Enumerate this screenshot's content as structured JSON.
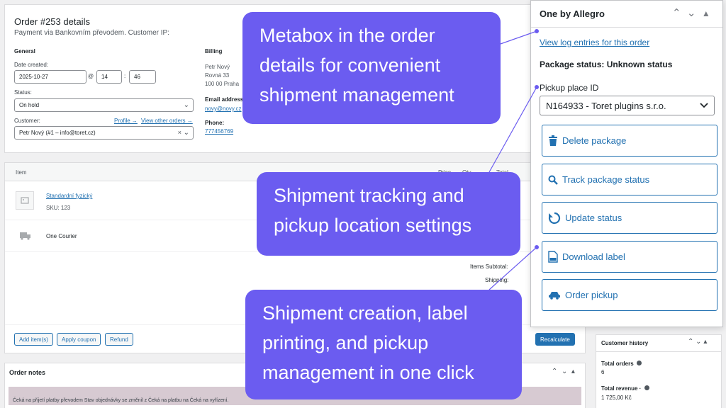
{
  "order": {
    "title": "Order #253 details",
    "subtitle": "Payment via Bankovním převodem. Customer IP:",
    "general_heading": "General",
    "date_label": "Date created:",
    "date_value": "2025-10-27",
    "at_sign": "@",
    "hour": "14",
    "colon": ":",
    "minute": "46",
    "status_label": "Status:",
    "status_value": "On hold",
    "customer_label": "Customer:",
    "profile_link": "Profile →",
    "other_orders_link": "View other orders →",
    "customer_value": "Petr Nový (#1 – info@toret.cz)",
    "billing_heading": "Billing",
    "billing_name": "Petr Nový",
    "billing_street": "Rovná 33",
    "billing_city": "100 00 Praha",
    "email_label": "Email address:",
    "email_value": "novy@novy.cz",
    "phone_label": "Phone:",
    "phone_value": "777456769"
  },
  "items": {
    "col_item": "Item",
    "col_price": "Price",
    "col_qty": "Qty",
    "col_total": "Total",
    "product_name": "Standardní fyzický",
    "product_sku": "SKU: 123",
    "shipping_name": "One Courier",
    "subtotal_label": "Items Subtotal:",
    "shipping_label": "Shipping:",
    "add_items": "Add item(s)",
    "apply_coupon": "Apply coupon",
    "refund": "Refund",
    "recalculate": "Recalculate"
  },
  "notes": {
    "title": "Order notes",
    "note_text": "Čeká na přijetí platby převodem Stav objednávky se změnil z Čeká na platbu na Čeká na vyřízení."
  },
  "customer_history": {
    "title": "Customer history",
    "total_orders_label": "Total orders",
    "total_orders_value": "6",
    "total_revenue_label": "Total revenue ·",
    "total_revenue_value": "1 725,00 Kč"
  },
  "metabox": {
    "title": "One by Allegro",
    "log_link": "View log entries for this order",
    "package_status": "Package status: Unknown status",
    "pickup_label": "Pickup place ID",
    "pickup_value": "N164933 - Toret plugins s.r.o.",
    "buttons": [
      {
        "label": "Delete package",
        "icon": "trash-icon"
      },
      {
        "label": "Track package status",
        "icon": "search-icon"
      },
      {
        "label": "Update status",
        "icon": "refresh-icon"
      },
      {
        "label": "Download label",
        "icon": "pdf-file-icon"
      },
      {
        "label": "Order pickup",
        "icon": "car-icon"
      }
    ]
  },
  "callouts": {
    "metabox": "Metabox in the order details for convenient shipment management",
    "tracking": "Shipment tracking and pickup location settings",
    "creation": "Shipment creation, label printing, and pickup management in one click"
  },
  "colors": {
    "accent": "#6b5cf0",
    "link": "#2271b1"
  }
}
